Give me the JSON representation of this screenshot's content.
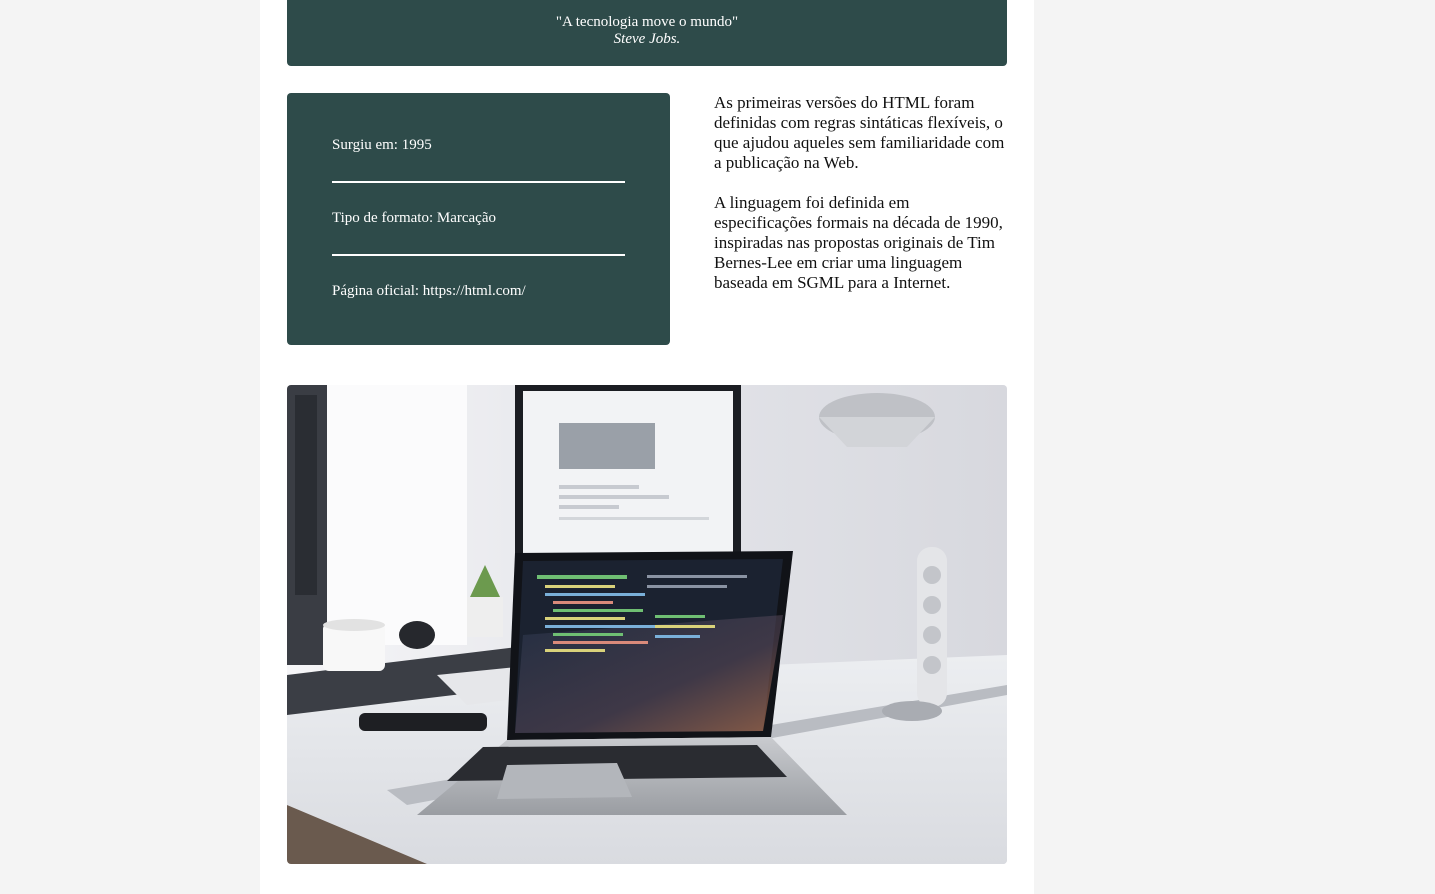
{
  "quote": {
    "text": "\"A tecnologia move o mundo\"",
    "author": "Steve Jobs."
  },
  "info": {
    "released": "Surgiu em: 1995",
    "format": "Tipo de formato: Marcação",
    "official_page": "Página oficial: https://html.com/"
  },
  "description": {
    "paragraphs": [
      "As primeiras versões do HTML foram definidas com regras sintáticas flexíveis, o que ajudou aqueles sem familiaridade com a publicação na Web.",
      "A linguagem foi definida em especificações formais na década de 1990, inspiradas nas propostas originais de Tim Bernes-Lee em criar uma linguagem baseada em SGML para a Internet."
    ]
  },
  "colors": {
    "card_bg": "#2e4b4a",
    "page_bg": "#f4f4f4"
  }
}
